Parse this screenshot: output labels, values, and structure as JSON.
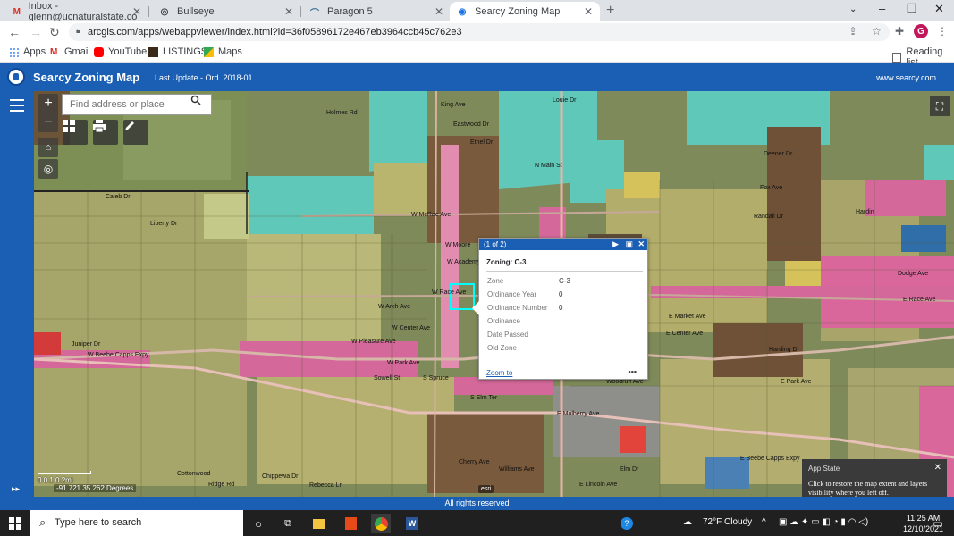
{
  "browser": {
    "tabs": [
      {
        "title": "Inbox - glenn@ucnaturalstate.co",
        "icon": "gmail-icon",
        "active": false
      },
      {
        "title": "Bullseye",
        "icon": "target-icon",
        "active": false
      },
      {
        "title": "Paragon 5",
        "icon": "paragon-icon",
        "active": false
      },
      {
        "title": "Searcy Zoning Map",
        "icon": "arcgis-icon",
        "active": true
      }
    ],
    "url": "arcgis.com/apps/webappviewer/index.html?id=36f05896172e467eb3964ccb45c762e3",
    "profile_initial": "G",
    "bookmarks": [
      "Apps",
      "Gmail",
      "YouTube",
      "LISTINGS",
      "Maps"
    ],
    "reading_list": "Reading list"
  },
  "app": {
    "title": "Searcy Zoning Map",
    "subtitle": "Last Update - Ord. 2018-01",
    "site": "www.searcy.com",
    "search_placeholder": "Find address or place",
    "footer": "All rights reserved",
    "scale_labels": "0    0.1    0.2mi",
    "coordinates": "-91.721 35.262 Degrees",
    "attribution": "esri"
  },
  "map_labels": [
    "Holmes Rd",
    "King Ave",
    "Eastwood Dr",
    "Ethel Dr",
    "Louie Dr",
    "Caleb Dr",
    "Liberty Dr",
    "W McRae Ave",
    "W Moore",
    "W Academy",
    "W Race Ave",
    "W Arch Ave",
    "W Center Ave",
    "W Pleasure Ave",
    "W Park Ave",
    "W Beebe Capps Expy",
    "Juniper Dr",
    "S Elm Ter",
    "E Mulberry Ave",
    "Woodruff Ave",
    "E Market Ave",
    "E Center Ave",
    "E Park Ave",
    "E Race Ave",
    "E Beebe Capps Expy",
    "Dodge Ave",
    "Deener Dr",
    "Fox Ave",
    "Randall Dr",
    "Hardin",
    "Harding Dr",
    "Elm Dr",
    "Williams Ave",
    "E Lincoln Ave",
    "Chippewa Dr",
    "Rebecca Ln",
    "Cottonwood",
    "Ridge Rd",
    "Cherry Ave",
    "N Main St",
    "Sowell St",
    "S Spruce"
  ],
  "popup": {
    "count": "(1 of 2)",
    "title": "Zoning: C-3",
    "fields": [
      {
        "label": "Zone",
        "value": "C-3"
      },
      {
        "label": "Ordinance Year",
        "value": "0"
      },
      {
        "label": "Ordinance Number",
        "value": "0"
      },
      {
        "label": "Ordinance",
        "value": ""
      },
      {
        "label": "Date Passed",
        "value": ""
      },
      {
        "label": "Old Zone",
        "value": ""
      }
    ],
    "zoom_link": "Zoom to",
    "more": "•••"
  },
  "app_state": {
    "title": "App State",
    "message": "Click to restore the map extent and layers visibility where you left off."
  },
  "taskbar": {
    "search_placeholder": "Type here to search",
    "weather": "72°F  Cloudy",
    "time": "11:25 AM",
    "date": "12/10/2021"
  },
  "colors": {
    "accent": "#1a5fb4",
    "zone_commercial": "#d4689a",
    "zone_residential": "#c9c47a",
    "zone_agricultural": "#5fc4b4",
    "zone_industrial": "#7a5a3c"
  }
}
